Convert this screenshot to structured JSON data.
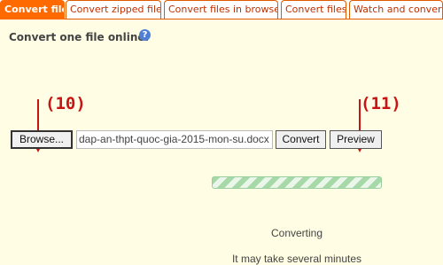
{
  "tabs": [
    {
      "label": "Convert file",
      "active": true
    },
    {
      "label": "Convert zipped files",
      "active": false
    },
    {
      "label": "Convert files in browser",
      "active": false
    },
    {
      "label": "Convert files",
      "active": false
    },
    {
      "label": "Watch and convert",
      "active": false
    }
  ],
  "main": {
    "heading": "Convert one file online:",
    "help_icon": "question-icon",
    "browse_label": "Browse...",
    "file_name": "dap-an-thpt-quoc-gia-2015-mon-su.docx",
    "convert_label": "Convert",
    "preview_label": "Preview",
    "status": "Converting",
    "note": "It may take several minutes"
  },
  "annotations": {
    "left": "(10)",
    "right": "(11)"
  },
  "colors": {
    "tab_accent": "#ff6a00",
    "panel_bg": "#fffde3",
    "annotation": "#c81414",
    "progress": "#a7d8a7"
  }
}
